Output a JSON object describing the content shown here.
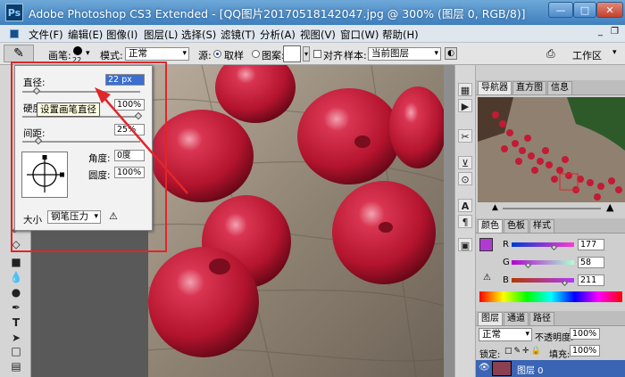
{
  "window": {
    "app_logo": "Ps",
    "title": "Adobe Photoshop CS3 Extended - [QQ图片20170518142047.jpg @ 300% (图层 0, RGB/8)]",
    "min_label": "—",
    "max_label": "□",
    "close_label": "✕"
  },
  "menubar": {
    "items": [
      "文件(F)",
      "编辑(E)",
      "图像(I)",
      "图层(L)",
      "选择(S)",
      "滤镜(T)",
      "分析(A)",
      "视图(V)",
      "窗口(W)",
      "帮助(H)"
    ]
  },
  "options_bar": {
    "brush_label": "画笔:",
    "brush_size": "22",
    "mode_label": "模式:",
    "mode_value": "正常",
    "source_label": "源:",
    "sample_option": "取样",
    "pattern_option": "图案:",
    "aligned_label": "对齐",
    "sample_label": "样本:",
    "sample_value": "当前图层",
    "workspace_label": "工作区"
  },
  "brush_panel": {
    "diameter_label": "直径:",
    "diameter_value": "22 px",
    "hardness_label": "硬度",
    "hardness_value": "100%",
    "spacing_label": "间距:",
    "spacing_value": "25%",
    "angle_label": "角度:",
    "angle_value": "0度",
    "roundness_label": "圆度:",
    "roundness_value": "100%",
    "size_label": "大小",
    "size_value": "钢笔压力"
  },
  "tooltip": "设置画笔直径",
  "navigator": {
    "tabs": [
      "导航器",
      "直方图",
      "信息"
    ]
  },
  "color_panel": {
    "tabs": [
      "颜色",
      "色板",
      "样式"
    ],
    "r_label": "R",
    "g_label": "G",
    "b_label": "B",
    "r_value": "177",
    "g_value": "58",
    "b_value": "211",
    "r": 177,
    "g": 58,
    "b": 211,
    "fg_color": "#b13ad3"
  },
  "layers_panel": {
    "tabs": [
      "图层",
      "通道",
      "路径"
    ],
    "blend_mode": "正常",
    "opacity_label": "不透明度:",
    "opacity_value": "100%",
    "lock_label": "锁定:",
    "fill_label": "填充:",
    "fill_value": "100%",
    "layer_name": "图层 0"
  },
  "colors": {
    "accent_red": "#e0262a",
    "berry": "#b4142e"
  }
}
